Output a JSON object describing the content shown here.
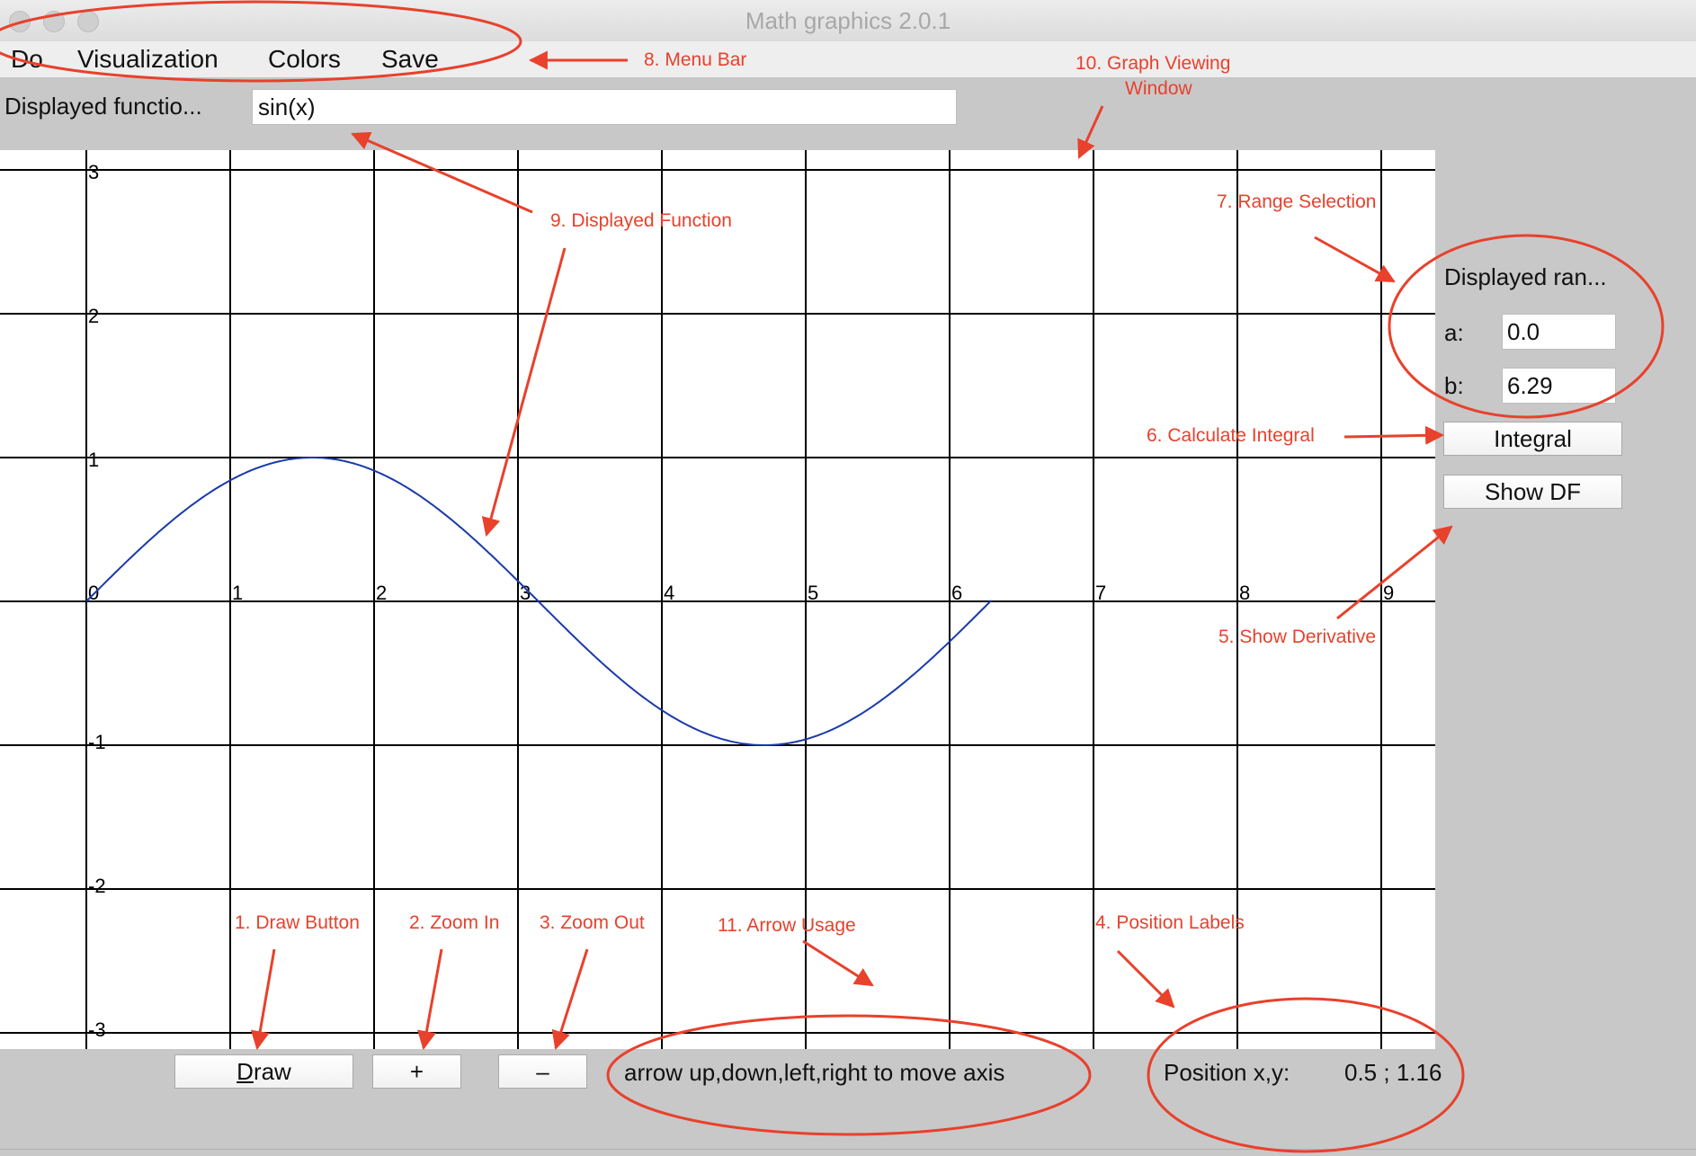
{
  "window": {
    "title": "Math graphics 2.0.1"
  },
  "menu": [
    "Do",
    "Visualization",
    "Colors",
    "Save"
  ],
  "function_row": {
    "label": "Displayed functio...",
    "value": "sin(x)"
  },
  "range": {
    "title": "Displayed ran...",
    "a_label": "a:",
    "a_value": "0.0",
    "b_label": "b:",
    "b_value": "6.29"
  },
  "buttons": {
    "integral": "Integral",
    "show_df": "Show DF",
    "draw_first": "D",
    "draw_rest": "raw",
    "zoom_in": "+",
    "zoom_out": "–"
  },
  "status": {
    "arrow_hint": "arrow up,down,left,right to move axis",
    "position_label": "Position x,y:",
    "position_value": "0.5 ; 1.16"
  },
  "graph": {
    "function": "sin(x)",
    "x_ticks": [
      "0",
      "1",
      "2",
      "3",
      "4",
      "5",
      "6",
      "7",
      "8",
      "9"
    ],
    "y_ticks": [
      "3",
      "2",
      "1",
      "-1",
      "-2",
      "-3"
    ],
    "x_range": [
      0,
      6.29
    ],
    "curve_color": "#1a3aa8",
    "grid_color": "#000000"
  },
  "annotations": {
    "color": "#e8412c",
    "items": [
      "8. Menu Bar",
      "10. Graph Viewing",
      "Window",
      "9. Displayed Function",
      "7. Range Selection",
      "6. Calculate Integral",
      "5. Show Derivative",
      "1. Draw Button",
      "2. Zoom In",
      "3. Zoom Out",
      "11. Arrow Usage",
      "4. Position Labels"
    ]
  }
}
